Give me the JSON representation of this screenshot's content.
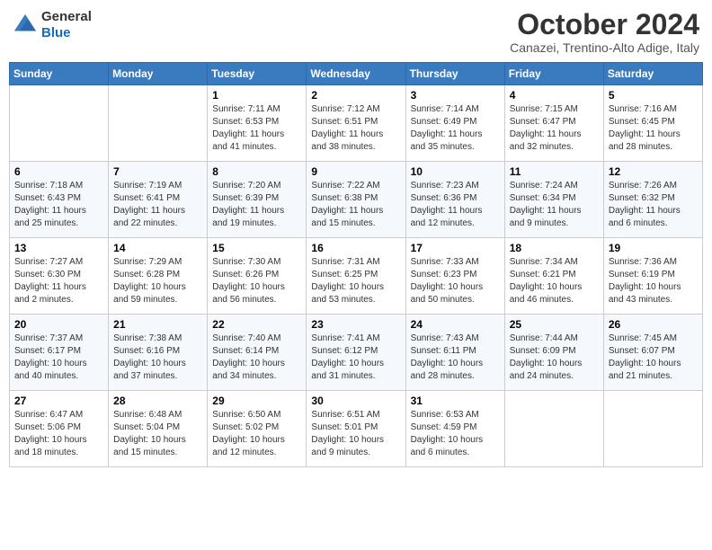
{
  "logo": {
    "general": "General",
    "blue": "Blue"
  },
  "header": {
    "title": "October 2024",
    "location": "Canazei, Trentino-Alto Adige, Italy"
  },
  "days_of_week": [
    "Sunday",
    "Monday",
    "Tuesday",
    "Wednesday",
    "Thursday",
    "Friday",
    "Saturday"
  ],
  "weeks": [
    [
      {
        "day": "",
        "info": ""
      },
      {
        "day": "",
        "info": ""
      },
      {
        "day": "1",
        "info": "Sunrise: 7:11 AM\nSunset: 6:53 PM\nDaylight: 11 hours and 41 minutes."
      },
      {
        "day": "2",
        "info": "Sunrise: 7:12 AM\nSunset: 6:51 PM\nDaylight: 11 hours and 38 minutes."
      },
      {
        "day": "3",
        "info": "Sunrise: 7:14 AM\nSunset: 6:49 PM\nDaylight: 11 hours and 35 minutes."
      },
      {
        "day": "4",
        "info": "Sunrise: 7:15 AM\nSunset: 6:47 PM\nDaylight: 11 hours and 32 minutes."
      },
      {
        "day": "5",
        "info": "Sunrise: 7:16 AM\nSunset: 6:45 PM\nDaylight: 11 hours and 28 minutes."
      }
    ],
    [
      {
        "day": "6",
        "info": "Sunrise: 7:18 AM\nSunset: 6:43 PM\nDaylight: 11 hours and 25 minutes."
      },
      {
        "day": "7",
        "info": "Sunrise: 7:19 AM\nSunset: 6:41 PM\nDaylight: 11 hours and 22 minutes."
      },
      {
        "day": "8",
        "info": "Sunrise: 7:20 AM\nSunset: 6:39 PM\nDaylight: 11 hours and 19 minutes."
      },
      {
        "day": "9",
        "info": "Sunrise: 7:22 AM\nSunset: 6:38 PM\nDaylight: 11 hours and 15 minutes."
      },
      {
        "day": "10",
        "info": "Sunrise: 7:23 AM\nSunset: 6:36 PM\nDaylight: 11 hours and 12 minutes."
      },
      {
        "day": "11",
        "info": "Sunrise: 7:24 AM\nSunset: 6:34 PM\nDaylight: 11 hours and 9 minutes."
      },
      {
        "day": "12",
        "info": "Sunrise: 7:26 AM\nSunset: 6:32 PM\nDaylight: 11 hours and 6 minutes."
      }
    ],
    [
      {
        "day": "13",
        "info": "Sunrise: 7:27 AM\nSunset: 6:30 PM\nDaylight: 11 hours and 2 minutes."
      },
      {
        "day": "14",
        "info": "Sunrise: 7:29 AM\nSunset: 6:28 PM\nDaylight: 10 hours and 59 minutes."
      },
      {
        "day": "15",
        "info": "Sunrise: 7:30 AM\nSunset: 6:26 PM\nDaylight: 10 hours and 56 minutes."
      },
      {
        "day": "16",
        "info": "Sunrise: 7:31 AM\nSunset: 6:25 PM\nDaylight: 10 hours and 53 minutes."
      },
      {
        "day": "17",
        "info": "Sunrise: 7:33 AM\nSunset: 6:23 PM\nDaylight: 10 hours and 50 minutes."
      },
      {
        "day": "18",
        "info": "Sunrise: 7:34 AM\nSunset: 6:21 PM\nDaylight: 10 hours and 46 minutes."
      },
      {
        "day": "19",
        "info": "Sunrise: 7:36 AM\nSunset: 6:19 PM\nDaylight: 10 hours and 43 minutes."
      }
    ],
    [
      {
        "day": "20",
        "info": "Sunrise: 7:37 AM\nSunset: 6:17 PM\nDaylight: 10 hours and 40 minutes."
      },
      {
        "day": "21",
        "info": "Sunrise: 7:38 AM\nSunset: 6:16 PM\nDaylight: 10 hours and 37 minutes."
      },
      {
        "day": "22",
        "info": "Sunrise: 7:40 AM\nSunset: 6:14 PM\nDaylight: 10 hours and 34 minutes."
      },
      {
        "day": "23",
        "info": "Sunrise: 7:41 AM\nSunset: 6:12 PM\nDaylight: 10 hours and 31 minutes."
      },
      {
        "day": "24",
        "info": "Sunrise: 7:43 AM\nSunset: 6:11 PM\nDaylight: 10 hours and 28 minutes."
      },
      {
        "day": "25",
        "info": "Sunrise: 7:44 AM\nSunset: 6:09 PM\nDaylight: 10 hours and 24 minutes."
      },
      {
        "day": "26",
        "info": "Sunrise: 7:45 AM\nSunset: 6:07 PM\nDaylight: 10 hours and 21 minutes."
      }
    ],
    [
      {
        "day": "27",
        "info": "Sunrise: 6:47 AM\nSunset: 5:06 PM\nDaylight: 10 hours and 18 minutes."
      },
      {
        "day": "28",
        "info": "Sunrise: 6:48 AM\nSunset: 5:04 PM\nDaylight: 10 hours and 15 minutes."
      },
      {
        "day": "29",
        "info": "Sunrise: 6:50 AM\nSunset: 5:02 PM\nDaylight: 10 hours and 12 minutes."
      },
      {
        "day": "30",
        "info": "Sunrise: 6:51 AM\nSunset: 5:01 PM\nDaylight: 10 hours and 9 minutes."
      },
      {
        "day": "31",
        "info": "Sunrise: 6:53 AM\nSunset: 4:59 PM\nDaylight: 10 hours and 6 minutes."
      },
      {
        "day": "",
        "info": ""
      },
      {
        "day": "",
        "info": ""
      }
    ]
  ]
}
